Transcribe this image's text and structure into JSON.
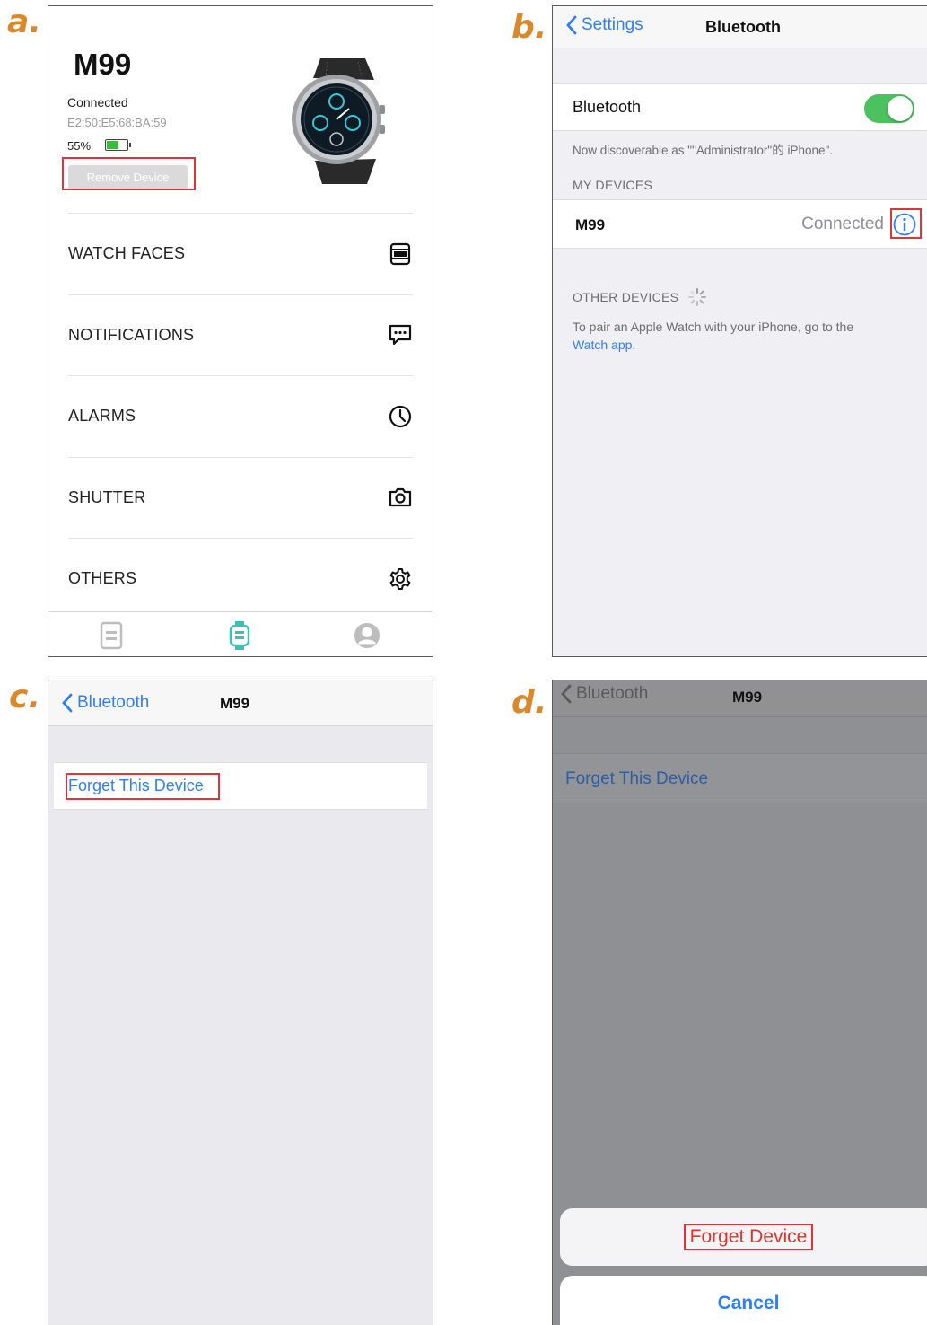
{
  "panel_labels": [
    "a.",
    "b.",
    "c.",
    "d."
  ],
  "colors": {
    "highlight": "#d9363e",
    "ios_blue": "#2f7ef5",
    "panel_label": "#d9892b",
    "toggle_on": "#4cc160"
  },
  "panel_a": {
    "device_name": "M99",
    "status": "Connected",
    "mac": "E2:50:E5:68:BA:59",
    "battery_text": "55%",
    "battery_level": 0.55,
    "remove_label": "Remove Device",
    "menu": [
      {
        "label": "WATCH FACES",
        "icon": "watch-face-icon"
      },
      {
        "label": "NOTIFICATIONS",
        "icon": "message-icon"
      },
      {
        "label": "ALARMS",
        "icon": "clock-icon"
      },
      {
        "label": "SHUTTER",
        "icon": "camera-icon"
      },
      {
        "label": "OTHERS",
        "icon": "gear-icon"
      }
    ],
    "tabs": [
      "document-icon",
      "watch-icon",
      "profile-icon"
    ]
  },
  "panel_b": {
    "back_label": "Settings",
    "title": "Bluetooth",
    "bluetooth_label": "Bluetooth",
    "bluetooth_on": true,
    "discoverable": "Now discoverable as \"\"Administrator\"的 iPhone\".",
    "my_devices_header": "MY DEVICES",
    "device_name": "M99",
    "device_status": "Connected",
    "other_devices_header": "OTHER DEVICES",
    "pair_text": "To pair an Apple Watch with your iPhone, go to the",
    "pair_link": "Watch app."
  },
  "panel_c": {
    "back_label": "Bluetooth",
    "title": "M99",
    "forget_label": "Forget This Device"
  },
  "panel_d": {
    "back_label": "Bluetooth",
    "title": "M99",
    "forget_label": "Forget This Device",
    "sheet_forget": "Forget Device",
    "sheet_cancel": "Cancel"
  }
}
